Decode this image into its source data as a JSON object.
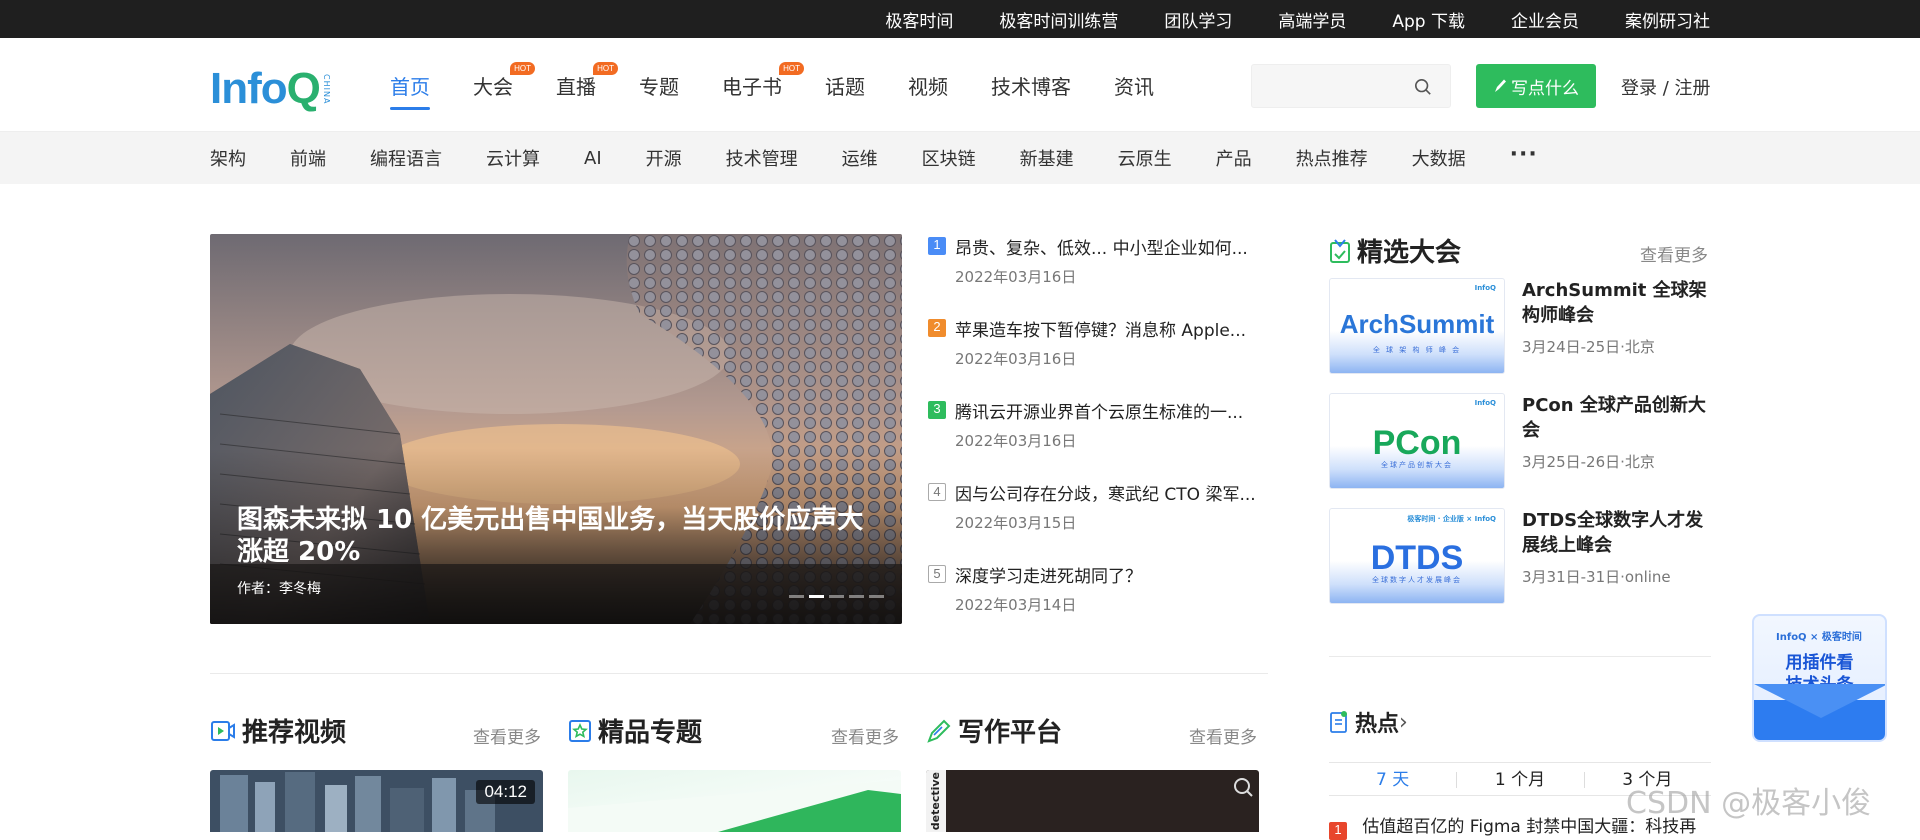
{
  "topbar": {
    "links": [
      "极客时间",
      "极客时间训练营",
      "团队学习",
      "高端学员",
      "App 下载",
      "企业会员",
      "案例研习社"
    ]
  },
  "header": {
    "logo_text": "InfoQ",
    "logo_tag": "CHINA",
    "nav": [
      {
        "label": "首页",
        "active": true,
        "hot": false
      },
      {
        "label": "大会",
        "active": false,
        "hot": true
      },
      {
        "label": "直播",
        "active": false,
        "hot": true
      },
      {
        "label": "专题",
        "active": false,
        "hot": false
      },
      {
        "label": "电子书",
        "active": false,
        "hot": true
      },
      {
        "label": "话题",
        "active": false,
        "hot": false
      },
      {
        "label": "视频",
        "active": false,
        "hot": false
      },
      {
        "label": "技术博客",
        "active": false,
        "hot": false
      },
      {
        "label": "资讯",
        "active": false,
        "hot": false
      }
    ],
    "hot_label": "HOT",
    "search_placeholder": "",
    "write_label": "写点什么",
    "login": "登录",
    "sep": " / ",
    "register": "注册"
  },
  "categories": [
    "架构",
    "前端",
    "编程语言",
    "云计算",
    "AI",
    "开源",
    "技术管理",
    "运维",
    "区块链",
    "新基建",
    "云原生",
    "产品",
    "热点推荐",
    "大数据"
  ],
  "more_glyph": "···",
  "hero": {
    "title": "图森未来拟 10 亿美元出售中国业务，当天股价应声大涨超 20%",
    "author": "作者：李冬梅",
    "slide_count": 5,
    "active_slide": 1
  },
  "news": [
    {
      "rank": "1",
      "title": "昂贵、复杂、低效... 中小型企业如何...",
      "date": "2022年03月16日"
    },
    {
      "rank": "2",
      "title": "苹果造车按下暂停键？消息称 Apple...",
      "date": "2022年03月16日"
    },
    {
      "rank": "3",
      "title": "腾讯云开源业界首个云原生标准的一...",
      "date": "2022年03月16日"
    },
    {
      "rank": "4",
      "title": "因与公司存在分歧，寒武纪 CTO 梁军...",
      "date": "2022年03月15日"
    },
    {
      "rank": "5",
      "title": "深度学习走进死胡同了？",
      "date": "2022年03月14日"
    }
  ],
  "conferences": {
    "heading": "精选大会",
    "more": "查看更多",
    "items": [
      {
        "brand": "ArchSummit",
        "sub": "全 球 架 构 师 峰 会",
        "mini": "InfoQ",
        "title": "ArchSummit 全球架构师峰会",
        "date": "3月24日-25日·北京",
        "color": "#2a76d8"
      },
      {
        "brand": "PCon",
        "sub": "全球产品创新大会",
        "mini": "InfoQ",
        "title": "PCon 全球产品创新大会",
        "date": "3月25日-26日·北京",
        "color": "#18a85a"
      },
      {
        "brand": "DTDS",
        "sub": "全球数字人才发展峰会",
        "mini": "极客时间 · 企业版 × InfoQ",
        "title": "DTDS全球数字人才发展线上峰会",
        "date": "3月31日-31日·online",
        "color": "#2a6fe0"
      }
    ]
  },
  "hot": {
    "heading": "热点",
    "arrow": "›",
    "tabs": [
      {
        "label": "7 天",
        "active": true
      },
      {
        "label": "1 个月",
        "active": false
      },
      {
        "label": "3 个月",
        "active": false
      }
    ],
    "first_rank": "1",
    "first_title": "估值超百亿的 Figma 封禁中国大疆：科技再"
  },
  "sections": [
    {
      "heading": "推荐视频",
      "more": "查看更多",
      "badge": "04:12"
    },
    {
      "heading": "精品专题",
      "more": "查看更多"
    },
    {
      "heading": "写作平台",
      "more": "查看更多",
      "vertical": "detective"
    }
  ],
  "plugin": {
    "top": "InfoQ × 极客时间",
    "line1": "用插件看",
    "line2": "技术头条"
  },
  "watermark": "CSDN @极客小俊",
  "colors": {
    "accent": "#2b7de9",
    "write_button": "#2ebc5d",
    "hot": "#f26b22",
    "topbar": "#1f1f1f"
  }
}
